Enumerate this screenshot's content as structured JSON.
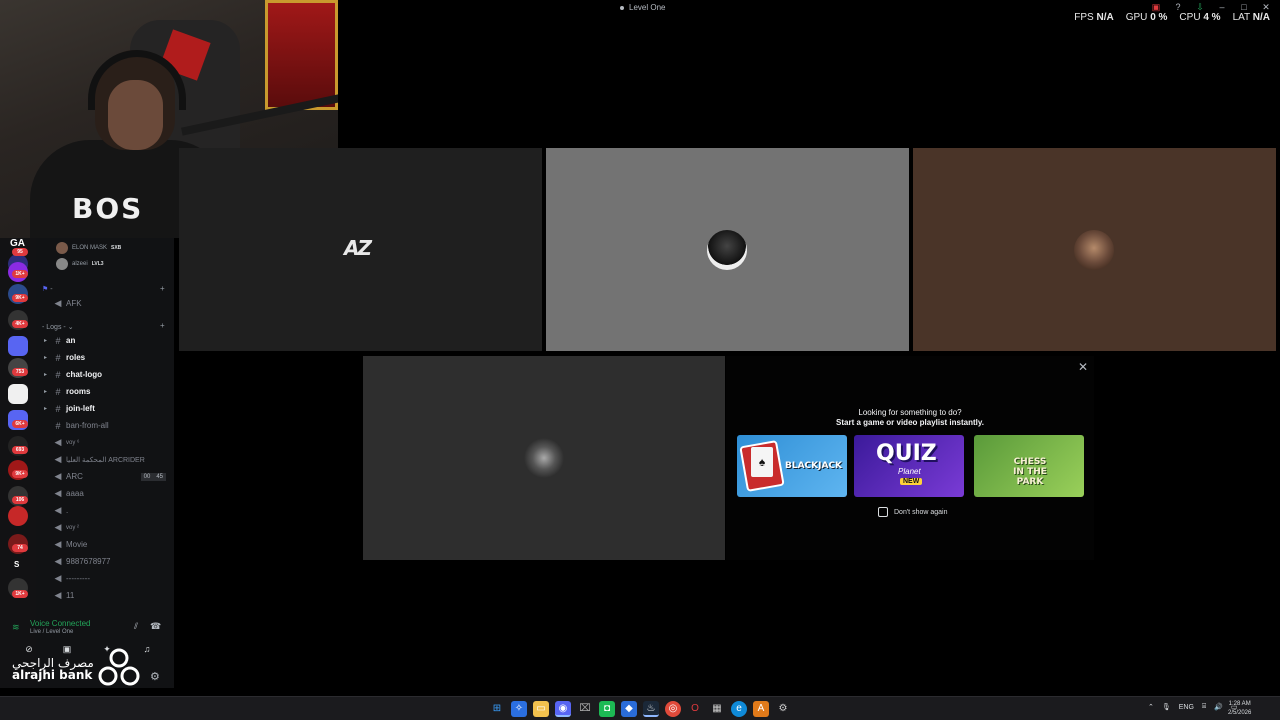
{
  "window": {
    "title": "Level One"
  },
  "perf": [
    {
      "label": "FPS",
      "value": "N/A"
    },
    {
      "label": "GPU",
      "value": "0 %"
    },
    {
      "label": "CPU",
      "value": "4 %"
    },
    {
      "label": "LAT",
      "value": "N/A"
    }
  ],
  "webcam": {
    "shirt_text": "BOS"
  },
  "rail": {
    "top_letter": "GA",
    "badges": [
      "95",
      "1K+",
      "9K+",
      "4K+",
      "753",
      "6K+",
      "8K+",
      "693",
      "9K+",
      "106",
      "74",
      "1K+"
    ],
    "s_letter": "S"
  },
  "voice_users": [
    {
      "name": "ELON MASK",
      "tag": "SXB"
    },
    {
      "name": "alzeei",
      "tag": "LVL3"
    }
  ],
  "categories": [
    {
      "label": "-"
    },
    {
      "label": "- Logs -"
    }
  ],
  "channels": [
    {
      "name": "AFK",
      "type": "voice",
      "bright": false
    },
    {
      "name": "an",
      "type": "text",
      "bright": true
    },
    {
      "name": "roles",
      "type": "text",
      "bright": true
    },
    {
      "name": "chat-logo",
      "type": "text",
      "bright": true
    },
    {
      "name": "rooms",
      "type": "text",
      "bright": true
    },
    {
      "name": "join-left",
      "type": "text",
      "bright": true
    },
    {
      "name": "ban-from-all",
      "type": "text",
      "bright": false
    },
    {
      "name": "voy ⁶",
      "type": "voice",
      "bright": false
    },
    {
      "name": "المحكمة العليا ARCRIDER",
      "type": "voice",
      "bright": false
    },
    {
      "name": "ARC",
      "type": "voice",
      "bright": false,
      "counts": [
        "00",
        "45"
      ]
    },
    {
      "name": "aaaa",
      "type": "voice",
      "bright": false
    },
    {
      "name": ".",
      "type": "voice",
      "bright": false
    },
    {
      "name": "voy ²",
      "type": "voice",
      "bright": false
    },
    {
      "name": "Movie",
      "type": "voice",
      "bright": false
    },
    {
      "name": "9887678977",
      "type": "voice",
      "bright": false
    },
    {
      "name": "---------",
      "type": "voice",
      "bright": false
    },
    {
      "name": "11",
      "type": "voice",
      "bright": false
    }
  ],
  "voice_panel": {
    "status": "Voice Connected",
    "sub": "Live / Level One"
  },
  "bank": {
    "arabic": "مصرف الراجحي",
    "english": "alrajhi bank"
  },
  "tiles": {
    "az_logo": "AZ"
  },
  "activity": {
    "heading": "Looking for something to do?",
    "subheading": "Start a game or video playlist instantly.",
    "games": [
      {
        "label": "BLACKJACK"
      },
      {
        "label": "QUIZ",
        "sub": "Planet",
        "badge": "NEW"
      },
      {
        "label": "CHESS IN THE PARK"
      }
    ],
    "dont_show": "Don't show again"
  },
  "taskbar": {
    "lang": "ENG",
    "time": "1:28 AM",
    "date": "2/5/2026"
  }
}
